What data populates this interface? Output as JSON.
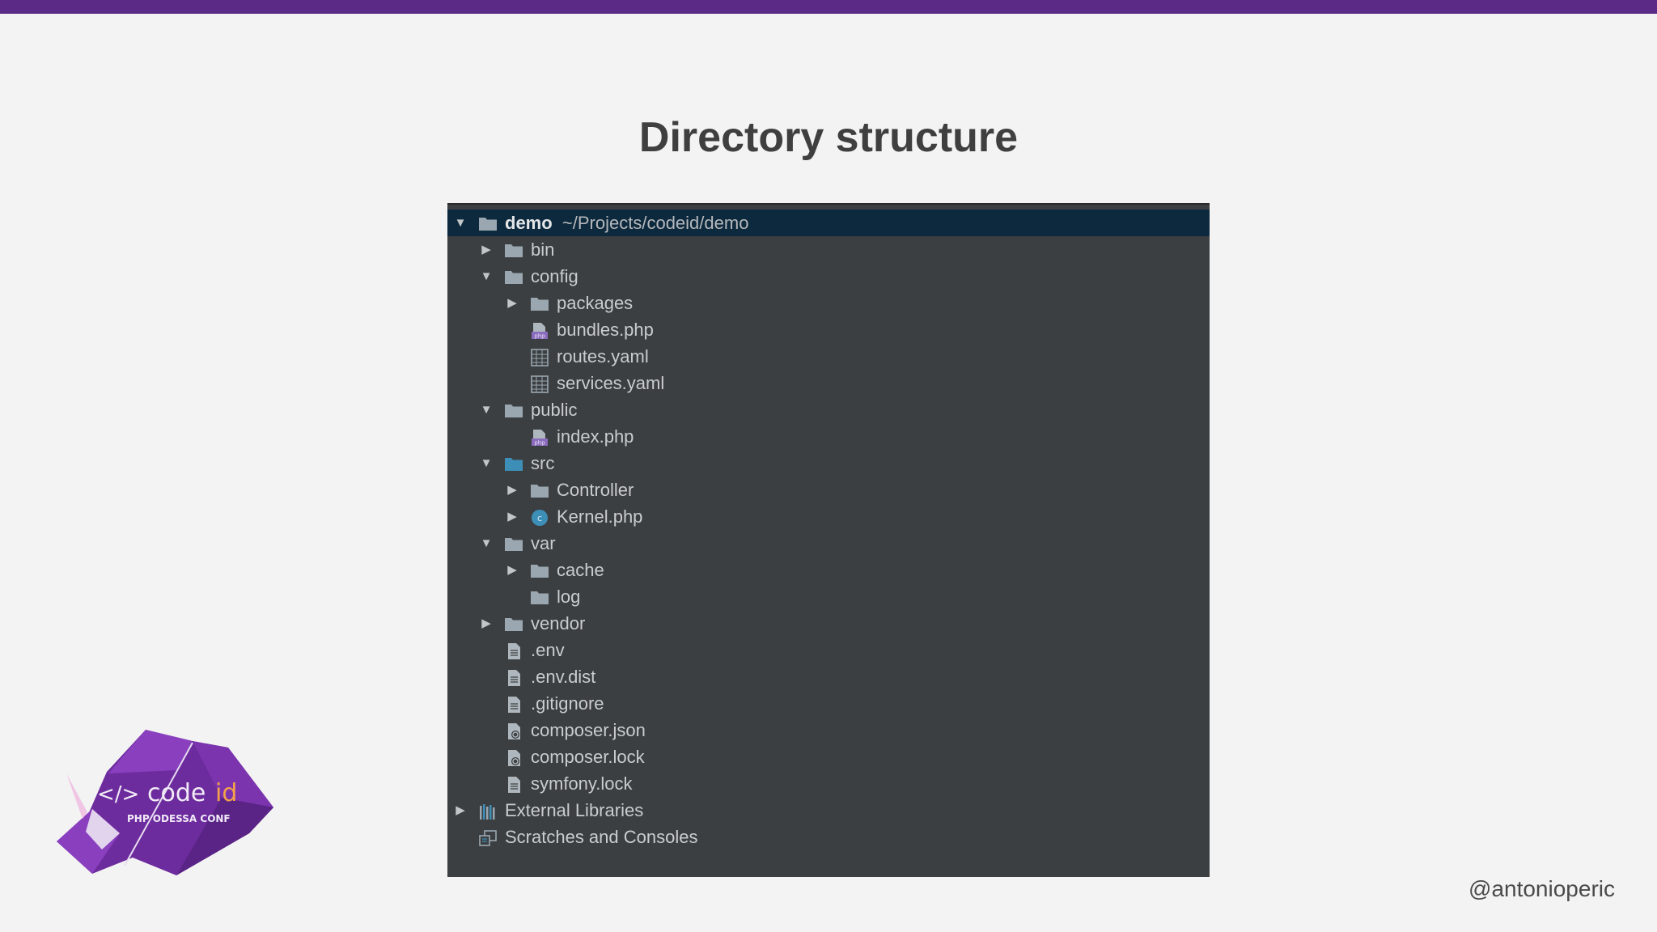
{
  "slide": {
    "title": "Directory structure",
    "handle": "@antonioperic"
  },
  "logo": {
    "code_prefix": "</>",
    "code_name": "code",
    "code_suffix": "id",
    "subtitle": "PHP ODESSA CONF"
  },
  "colors": {
    "accent_bar": "#5b2a86",
    "panel_bg": "#3c3f41",
    "selected_row": "#0d293e",
    "folder": "#9aa7b0",
    "src_folder": "#3d8fb8",
    "php_badge": "#8a6bbd"
  },
  "project_tree": {
    "root": {
      "name": "demo",
      "path": "~/Projects/codeid/demo"
    },
    "items": [
      {
        "label": "bin",
        "icon": "folder-icon",
        "toggle": "collapsed"
      },
      {
        "label": "config",
        "icon": "folder-icon",
        "toggle": "expanded"
      },
      {
        "label": "packages",
        "icon": "folder-icon",
        "toggle": "collapsed"
      },
      {
        "label": "bundles.php",
        "icon": "php-file-icon",
        "toggle": "none"
      },
      {
        "label": "routes.yaml",
        "icon": "yaml-file-icon",
        "toggle": "none"
      },
      {
        "label": "services.yaml",
        "icon": "yaml-file-icon",
        "toggle": "none"
      },
      {
        "label": "public",
        "icon": "folder-icon",
        "toggle": "expanded"
      },
      {
        "label": "index.php",
        "icon": "php-file-icon",
        "toggle": "none"
      },
      {
        "label": "src",
        "icon": "source-folder-icon",
        "toggle": "expanded"
      },
      {
        "label": "Controller",
        "icon": "folder-icon",
        "toggle": "collapsed"
      },
      {
        "label": "Kernel.php",
        "icon": "class-icon",
        "toggle": "collapsed"
      },
      {
        "label": "var",
        "icon": "folder-icon",
        "toggle": "expanded"
      },
      {
        "label": "cache",
        "icon": "folder-icon",
        "toggle": "collapsed"
      },
      {
        "label": "log",
        "icon": "folder-icon",
        "toggle": "none"
      },
      {
        "label": "vendor",
        "icon": "folder-icon",
        "toggle": "collapsed"
      },
      {
        "label": ".env",
        "icon": "text-file-icon",
        "toggle": "none"
      },
      {
        "label": ".env.dist",
        "icon": "text-file-icon",
        "toggle": "none"
      },
      {
        "label": ".gitignore",
        "icon": "text-file-icon",
        "toggle": "none"
      },
      {
        "label": "composer.json",
        "icon": "composer-file-icon",
        "toggle": "none"
      },
      {
        "label": "composer.lock",
        "icon": "composer-file-icon",
        "toggle": "none"
      },
      {
        "label": "symfony.lock",
        "icon": "text-file-icon",
        "toggle": "none"
      },
      {
        "label": "External Libraries",
        "icon": "libraries-icon",
        "toggle": "collapsed"
      },
      {
        "label": "Scratches and Consoles",
        "icon": "scratches-icon",
        "toggle": "none"
      }
    ]
  }
}
